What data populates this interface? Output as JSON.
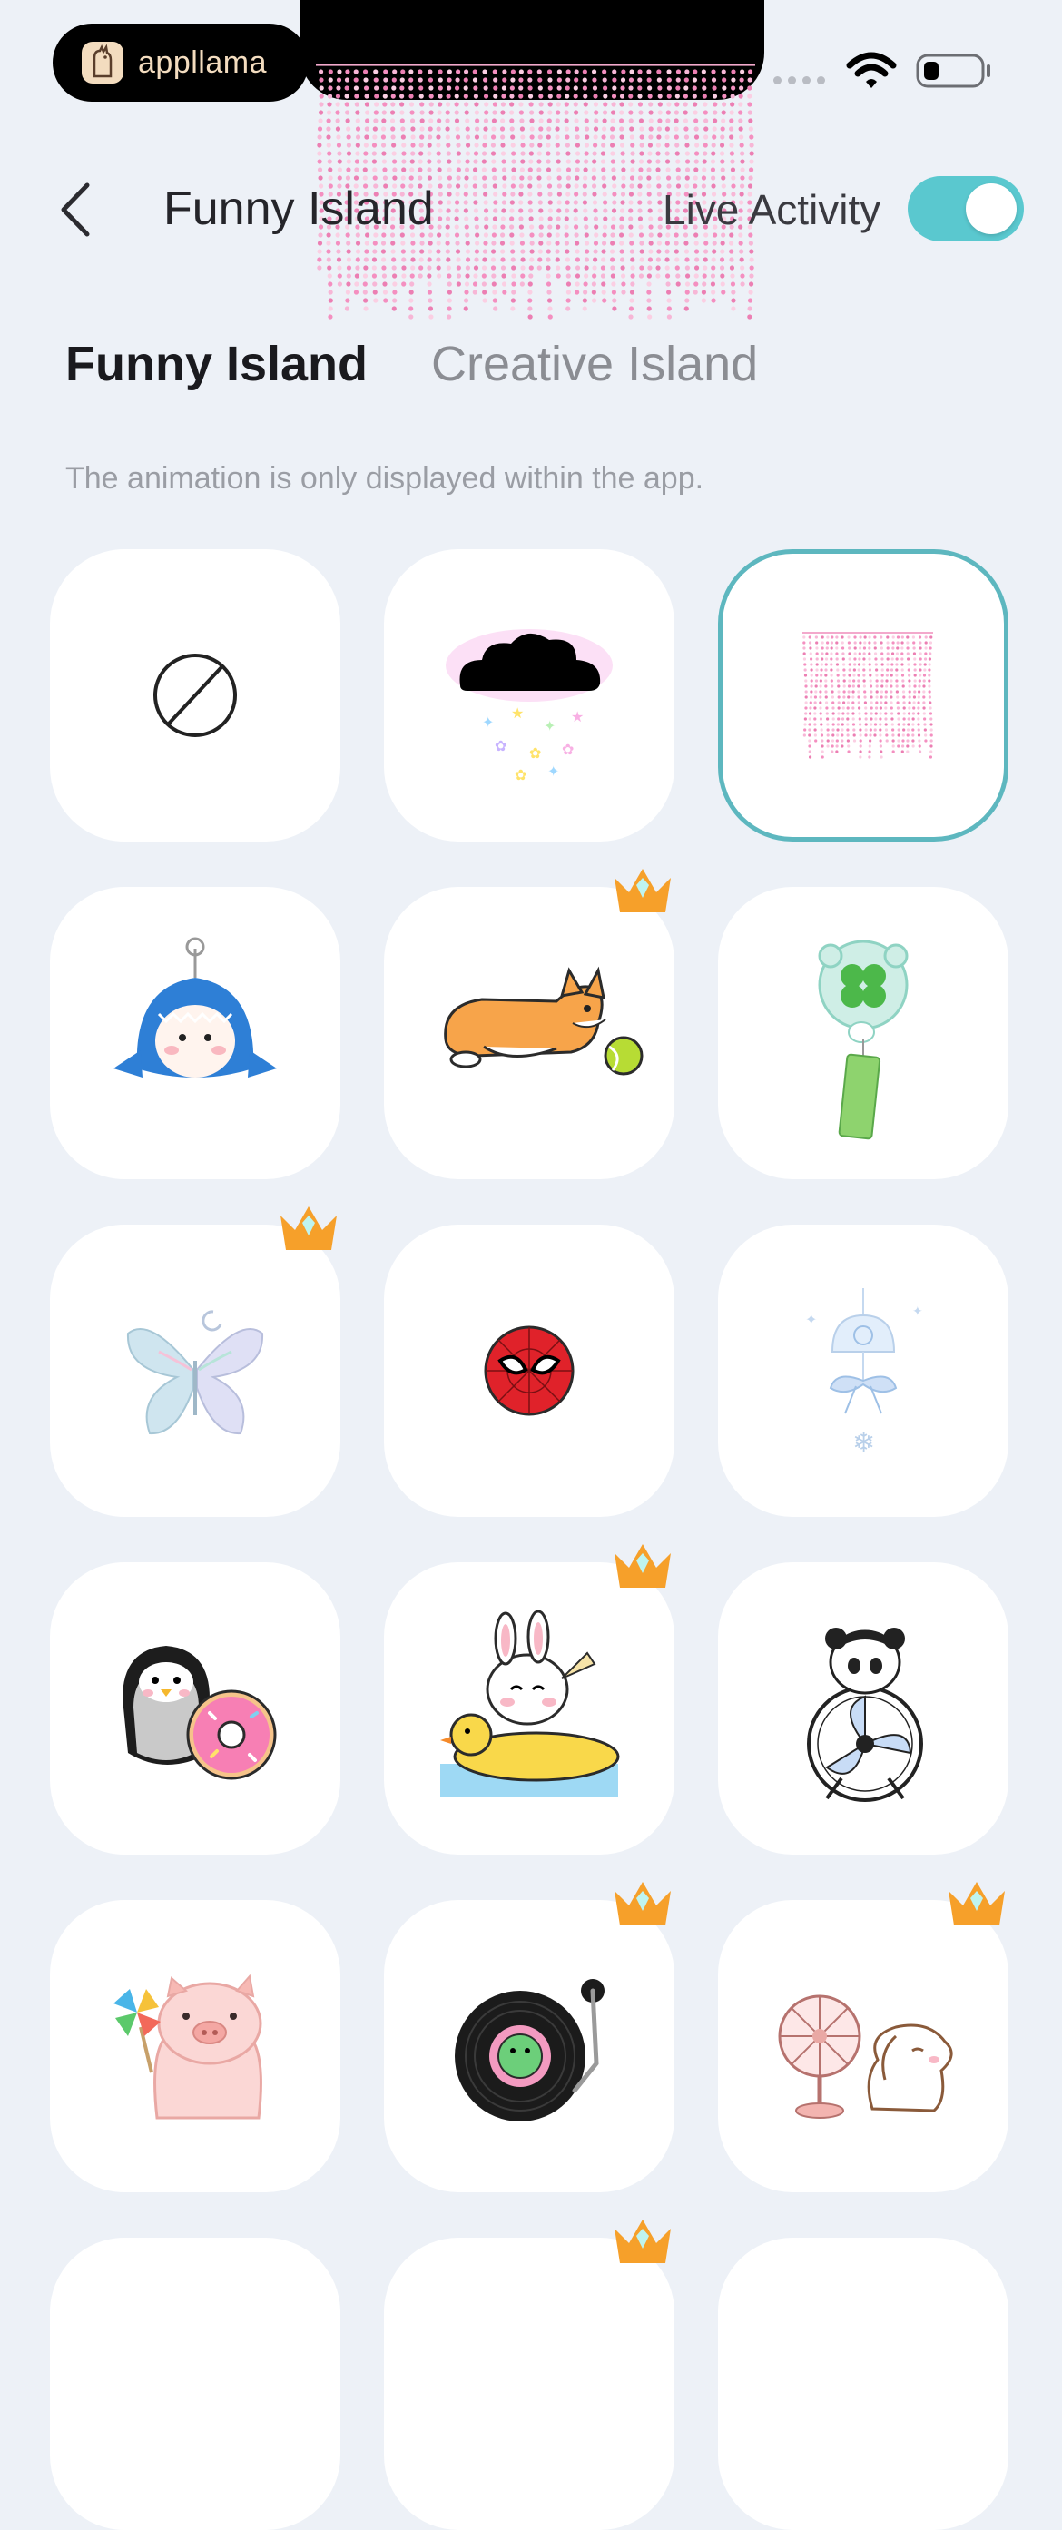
{
  "status_bar": {
    "brand_name": "appllama",
    "icons": [
      "appllama-logo-icon",
      "signal-dots-icon",
      "wifi-icon",
      "battery-icon"
    ]
  },
  "nav": {
    "title": "Funny Island",
    "live_activity_label": "Live Activity",
    "live_activity_enabled": true,
    "back_icon": "chevron-left-icon"
  },
  "tabs": [
    {
      "label": "Funny Island",
      "active": true
    },
    {
      "label": "Creative Island",
      "active": false
    }
  ],
  "notice": "The animation is only displayed within the app.",
  "colors": {
    "accent": "#5ac8cf",
    "selected_border": "#5db7bf",
    "background": "#edf1f7",
    "crown": "#f6a02a"
  },
  "items": [
    {
      "name": "none-icon",
      "premium": false,
      "selected": false
    },
    {
      "name": "cloud-rain-stars-icon",
      "premium": false,
      "selected": false
    },
    {
      "name": "pink-curtain-icon",
      "premium": false,
      "selected": true
    },
    {
      "name": "shark-plush-keychain-icon",
      "premium": false,
      "selected": false
    },
    {
      "name": "corgi-tennis-ball-icon",
      "premium": true,
      "selected": false
    },
    {
      "name": "clover-wind-chime-icon",
      "premium": false,
      "selected": false
    },
    {
      "name": "crystal-butterfly-icon",
      "premium": true,
      "selected": false
    },
    {
      "name": "spider-mask-icon",
      "premium": false,
      "selected": false
    },
    {
      "name": "jellyfish-wind-chime-icon",
      "premium": false,
      "selected": false
    },
    {
      "name": "penguin-donut-icon",
      "premium": false,
      "selected": false
    },
    {
      "name": "bunny-duck-float-icon",
      "premium": true,
      "selected": false
    },
    {
      "name": "panda-fan-icon",
      "premium": false,
      "selected": false
    },
    {
      "name": "pig-pinwheel-icon",
      "premium": false,
      "selected": false
    },
    {
      "name": "frog-vinyl-record-icon",
      "premium": true,
      "selected": false
    },
    {
      "name": "puppy-fan-icon",
      "premium": true,
      "selected": false
    },
    {
      "name": "partial-item-icon",
      "premium": false,
      "selected": false
    },
    {
      "name": "partial-item-icon",
      "premium": true,
      "selected": false
    },
    {
      "name": "partial-item-icon",
      "premium": false,
      "selected": false
    }
  ]
}
